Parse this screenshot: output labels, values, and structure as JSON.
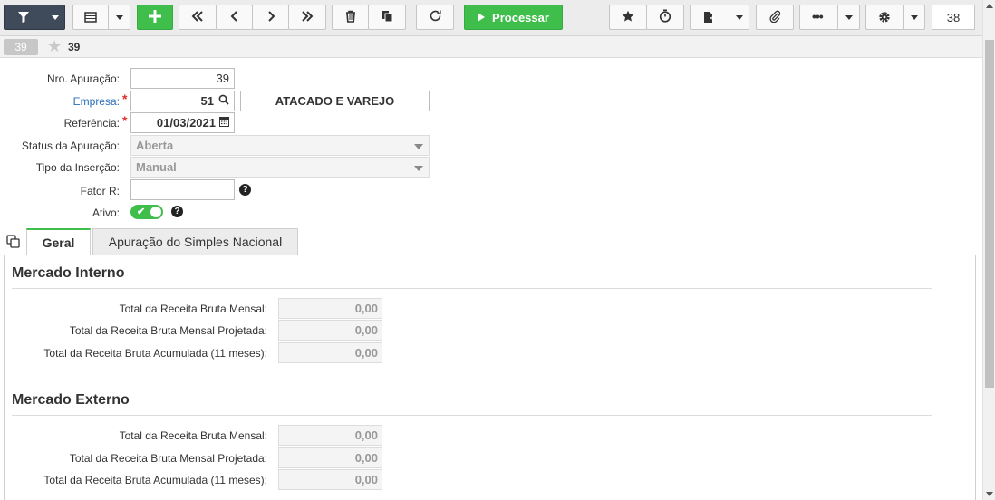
{
  "toolbar": {
    "process_label": "Processar",
    "record_count": "38"
  },
  "subbar": {
    "badge": "39",
    "record_id": "39"
  },
  "form": {
    "nro_apuracao": {
      "label": "Nro. Apuração:",
      "value": "39"
    },
    "empresa": {
      "label": "Empresa:",
      "value": "51",
      "description": "ATACADO E VAREJO"
    },
    "referencia": {
      "label": "Referência:",
      "value": "01/03/2021"
    },
    "status": {
      "label": "Status da Apuração:",
      "value": "Aberta"
    },
    "tipo_insercao": {
      "label": "Tipo da Inserção:",
      "value": "Manual"
    },
    "fator_r": {
      "label": "Fator R:",
      "value": ""
    },
    "ativo": {
      "label": "Ativo:",
      "value": true
    }
  },
  "tabs": [
    {
      "label": "Geral",
      "active": true
    },
    {
      "label": "Apuração do Simples Nacional",
      "active": false
    }
  ],
  "sections": [
    {
      "title": "Mercado Interno",
      "rows": [
        {
          "label": "Total da Receita Bruta Mensal:",
          "value": "0,00"
        },
        {
          "label": "Total da Receita Bruta Mensal Projetada:",
          "value": "0,00"
        },
        {
          "label": "Total da Receita Bruta Acumulada (11 meses):",
          "value": "0,00"
        }
      ]
    },
    {
      "title": "Mercado Externo",
      "rows": [
        {
          "label": "Total da Receita Bruta Mensal:",
          "value": "0,00"
        },
        {
          "label": "Total da Receita Bruta Mensal Projetada:",
          "value": "0,00"
        },
        {
          "label": "Total da Receita Bruta Acumulada (11 meses):",
          "value": "0,00"
        }
      ]
    }
  ],
  "colors": {
    "accent_green": "#3fbe4b",
    "filter_button": "#3f4a5a",
    "link_blue": "#2a6ebb",
    "required_red": "#e03030"
  },
  "icons": [
    "filter-icon",
    "grid-icon",
    "plus-icon",
    "first-icon",
    "previous-icon",
    "next-icon",
    "last-icon",
    "trash-icon",
    "copy-icon",
    "refresh-icon",
    "play-icon",
    "star-icon",
    "timer-icon",
    "export-icon",
    "paperclip-icon",
    "more-icon",
    "gear-icon",
    "search-icon",
    "calendar-icon",
    "help-icon"
  ]
}
